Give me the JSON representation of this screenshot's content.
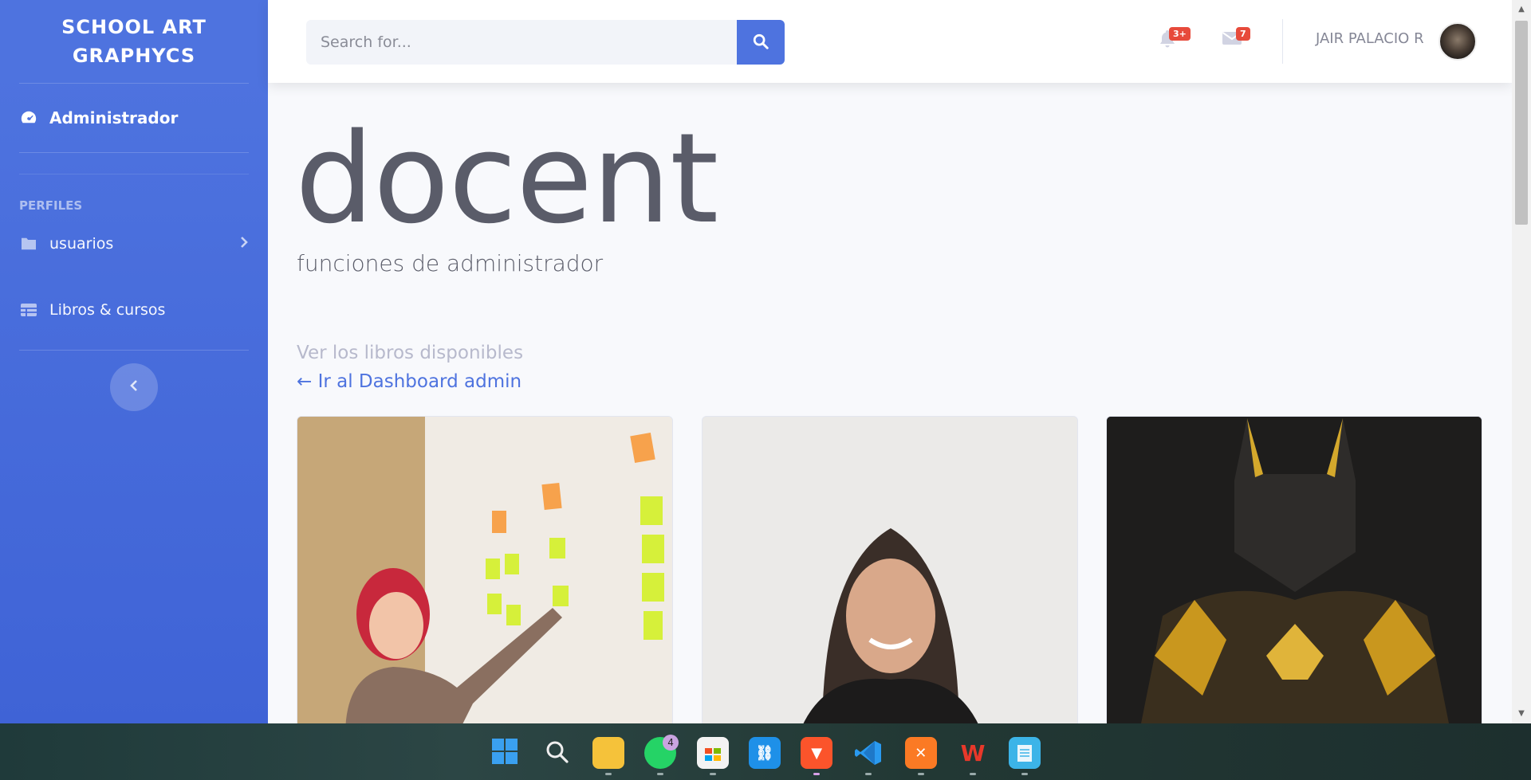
{
  "sidebar": {
    "brand_line1": "SCHOOL ART",
    "brand_line2": "GRAPHYCS",
    "active_item": "Administrador",
    "heading": "PERFILES",
    "items": [
      {
        "label": "usuarios",
        "icon": "folder-icon"
      },
      {
        "label": "Libros & cursos",
        "icon": "table-icon"
      }
    ]
  },
  "topbar": {
    "search_placeholder": "Search for...",
    "alerts_badge": "3+",
    "messages_badge": "7",
    "username": "JAIR PALACIO R"
  },
  "main": {
    "title": "docent",
    "subtitle": "funciones de administrador",
    "muted_text": "Ver los libros disponibles",
    "back_link": "← Ir al Dashboard admin"
  },
  "taskbar": {
    "whatsapp_badge": "4"
  },
  "colors": {
    "primary": "#4e73df",
    "badge": "#e74a3b",
    "text": "#5a5c69"
  }
}
